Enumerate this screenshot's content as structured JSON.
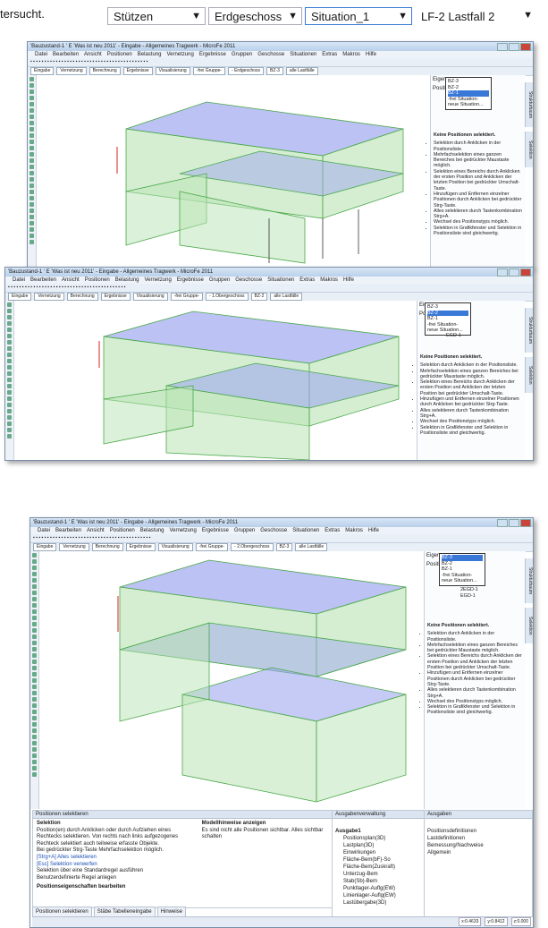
{
  "caption_text": "tersucht.",
  "top_combos": [
    {
      "value": "Stützen"
    },
    {
      "value": "Erdgeschoss"
    },
    {
      "value": "Situation_1"
    },
    {
      "value": "LF-2  Lastfall 2"
    }
  ],
  "windows": [
    {
      "title": "'Bauzustand-1 ' E 'Was ist neu 2011'  - Eingabe - Allgemeines Tragwerk - MicroFe 2011",
      "storey": "- Erdgeschoss",
      "situation": "BZ-3",
      "list_items": [
        "BZ-3",
        "BZ-2",
        "BZ-1",
        "-frei Situation-",
        "neue Situation..."
      ],
      "selected_index": 2,
      "status_title": "Keine Positionen selektiert."
    },
    {
      "title": "'Bauzustand-1 ' E 'Was ist neu 2011'  - Eingabe - Allgemeines Tragwerk - MicroFe 2011",
      "storey": "- 1.Obergeschoss",
      "situation": "BZ-2",
      "list_items": [
        "BZ-3",
        "BZ-2",
        "BZ-1",
        "-frei Situation-",
        "neue Situation..."
      ],
      "selected_index": 1,
      "extra_items": [
        "EGD-1"
      ],
      "status_title": "Keine Positionen selektiert."
    },
    {
      "title": "'Bauzustand-1 ' E 'Was ist neu 2011'  - Eingabe - Allgemeines Tragwerk - MicroFe 2011",
      "storey": "- 2.Obergeschoss",
      "situation": "BZ-3",
      "list_items": [
        "BZ-3",
        "BZ-2",
        "BZ-1",
        "-frei Situation-",
        "neue Situation..."
      ],
      "selected_index": 0,
      "extra_items": [
        "2EGD-1",
        "EGD-1"
      ],
      "status_title": "Keine Positionen selektiert."
    }
  ],
  "menus": [
    "Datei",
    "Bearbeiten",
    "Ansicht",
    "Positionen",
    "Belastung",
    "Vernetzung",
    "Ergebnisse",
    "Gruppen",
    "Geschosse",
    "Situationen",
    "Extras",
    "Makros",
    "Hilfe"
  ],
  "toolbar": {
    "eingabe": "Eingabe",
    "vernetzung": "Vernetzung",
    "berechnung": "Berechnung",
    "ergebnisse": "Ergebnisse",
    "visualisierung": "Visualisierung",
    "gruppe": "-frei Gruppe-",
    "lastfaelle": "alle Lastfälle"
  },
  "rpanel": {
    "eigen": "Eigen",
    "posi": "Positi"
  },
  "side_tabs": [
    "Strukturbaum",
    "Selektion"
  ],
  "hints": [
    "Selektion durch Anklicken in der Positionsliste.",
    "Mehrfachselektion eines ganzen Bereiches bei gedrückter Maustaste möglich.",
    "Selektion eines Bereichs durch Anklicken der ersten Position und Anklicken der letzten Position bei gedrückter Umschalt-Taste.",
    "Hinzufügen und Entfernen einzelner Positionen durch Anklicken bei gedrückter Strg-Taste.",
    "Alles selektieren durch Tastenkombination Strg+A.",
    "Wechsel des Positionstyps möglich.",
    "Selektion in Grafikfenster und Selektion in Positionsliste sind gleichwertig."
  ],
  "bottom": {
    "pos_panel_title": "Positionen selektieren",
    "selektion_heading": "Selektion",
    "selektion_lines": [
      "Position(en) durch Anklicken oder durch Aufziehen eines",
      "Rechtecks selektieren. Von rechts nach links aufgezogenes",
      "Rechteck selektiert auch teilweise erfasste Objekte.",
      "Bei gedrückter Strg-Taste Mehrfachselektion möglich.",
      "[Strg+A] Alles selektieren",
      "[Esc] Selektion verwerfen",
      "Selektion über eine Standardregel ausführen",
      "Benutzerdefinierte Regel anlegen"
    ],
    "posprops": "Positionseigenschaften bearbeiten",
    "modell_heading": "Modellhinweise anzeigen",
    "modell_text": "Es sind nicht alle Positionen sichtbar. Alles sichtbar schalten",
    "ausgaben_title": "Ausgabenverwaltung",
    "ausgabe_root": "Ausgabe1",
    "ausgabe_items": [
      "Positionsplan(3D)",
      "Lastplan(3D)",
      "Einwirkungen",
      "Fläche-Bem(bF)-So",
      "Fläche-Bem(Zuskraft)",
      "Unterzug-Bem",
      "Stab(Sb)-Bem",
      "Punktlager-Auflg(EW)",
      "Linienlager-Auflg(EW)",
      "Lastübergabe(3D)"
    ],
    "ausgaben2_title": "Ausgaben",
    "ausgaben2_items": [
      "Positionsdefinitionen",
      "Lastdefinitionen",
      "Bemessung/Nachweise",
      "Allgemein"
    ],
    "tabs": [
      "Positionen selektieren",
      "Stäbe Tabelleneingabe",
      "Hinweise"
    ],
    "status": [
      "x:0.4633",
      "y:0.8412",
      "z:0.000"
    ]
  },
  "colors": {
    "slab_blue": "#9fa8ef",
    "slab_green": "#b9e3b4",
    "edge_green": "#4aa84a",
    "highlight": "#3a78d8"
  }
}
